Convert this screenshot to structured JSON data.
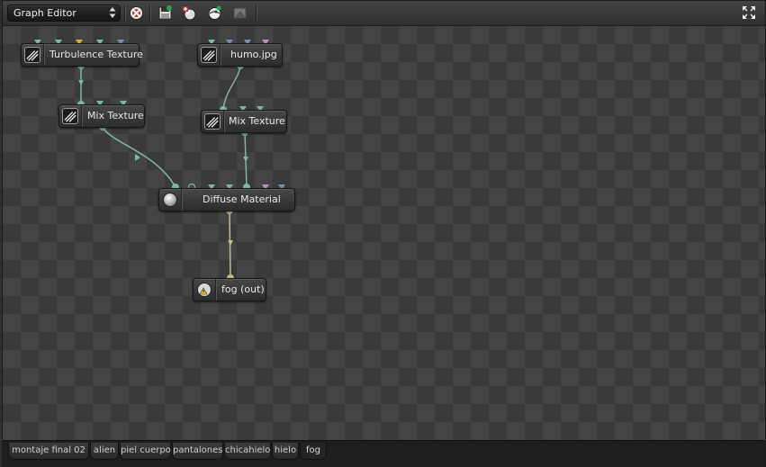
{
  "toolbar": {
    "editor_select": "Graph Editor",
    "buttons": [
      "clear-graph-icon",
      "save-graph-icon",
      "add-material-icon",
      "add-environment-icon",
      "render-preview-icon"
    ],
    "fullscreen": "fullscreen-icon"
  },
  "nodes": {
    "turbulence": "Turbulence Texture",
    "humo": "humo.jpg",
    "mix1": "Mix Texture",
    "mix2": "Mix Texture",
    "diffuse": "Diffuse Material",
    "out": "fog (out)"
  },
  "tabs": [
    "montaje final 02",
    "alien",
    "piel cuerpo",
    "pantalones",
    "chicahielo",
    "hielo",
    "fog"
  ],
  "active_tab": "fog",
  "colors": {
    "pin_teal": "#7fb7a1",
    "pin_yellow": "#e0b23c",
    "pin_blue": "#7c8fb3",
    "pin_pink": "#c48fc0",
    "wire_texture": "#7fb7a1",
    "wire_material": "#c8bb8f"
  }
}
